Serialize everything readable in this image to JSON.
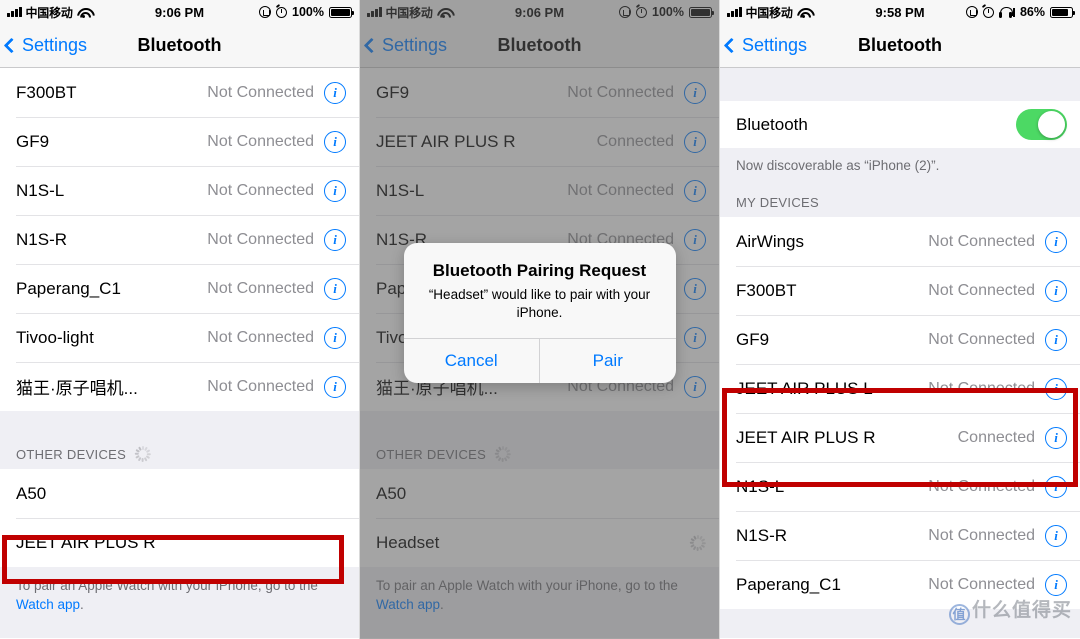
{
  "panels": [
    {
      "id": "panel-left",
      "statusbar": {
        "carrier": "中国移动",
        "time": "9:06 PM",
        "battery_percent": "100%",
        "icons": [
          "signal-bars-icon",
          "wifi-icon",
          "rotation-lock-icon",
          "alarm-clock-icon",
          "battery-icon"
        ]
      },
      "nav": {
        "back_label": "Settings",
        "title": "Bluetooth"
      },
      "devices": [
        {
          "name": "F300BT",
          "status": "Not Connected"
        },
        {
          "name": "GF9",
          "status": "Not Connected"
        },
        {
          "name": "N1S-L",
          "status": "Not Connected"
        },
        {
          "name": "N1S-R",
          "status": "Not Connected"
        },
        {
          "name": "Paperang_C1",
          "status": "Not Connected"
        },
        {
          "name": "Tivoo-light",
          "status": "Not Connected"
        },
        {
          "name": "猫王·原子唱机...",
          "status": "Not Connected"
        }
      ],
      "other_header": "OTHER DEVICES",
      "other_devices": [
        {
          "name": "A50",
          "status": ""
        },
        {
          "name": "JEET AIR PLUS R",
          "status": ""
        }
      ],
      "footer": {
        "text_before": "To pair an Apple Watch with your iPhone, go to the ",
        "link": "Watch app",
        "text_after": "."
      }
    },
    {
      "id": "panel-middle",
      "statusbar": {
        "carrier": "中国移动",
        "time": "9:06 PM",
        "battery_percent": "100%",
        "icons": [
          "signal-bars-icon",
          "wifi-icon",
          "rotation-lock-icon",
          "alarm-clock-icon",
          "battery-icon"
        ]
      },
      "nav": {
        "back_label": "Settings",
        "title": "Bluetooth"
      },
      "devices": [
        {
          "name": "GF9",
          "status": "Not Connected"
        },
        {
          "name": "JEET AIR PLUS R",
          "status": "Connected"
        },
        {
          "name": "N1S-L",
          "status": "Not Connected"
        },
        {
          "name": "N1S-R",
          "status": "Not Connected"
        },
        {
          "name": "Paperang_C1",
          "status": "Not Connected"
        },
        {
          "name": "Tivoo-light",
          "status": "Not Connected"
        },
        {
          "name": "猫王·原子唱机...",
          "status": "Not Connected"
        }
      ],
      "other_header": "OTHER DEVICES",
      "other_devices": [
        {
          "name": "A50",
          "status": ""
        },
        {
          "name": "Headset",
          "status": ""
        }
      ],
      "footer": {
        "text_before": "To pair an Apple Watch with your iPhone, go to the ",
        "link": "Watch app",
        "text_after": "."
      },
      "alert": {
        "title": "Bluetooth Pairing Request",
        "message": "“Headset” would like to pair with your iPhone.",
        "cancel_label": "Cancel",
        "confirm_label": "Pair"
      }
    },
    {
      "id": "panel-right",
      "statusbar": {
        "carrier": "中国移动",
        "time": "9:58 PM",
        "battery_percent": "86%",
        "icons": [
          "signal-bars-icon",
          "wifi-icon",
          "rotation-lock-icon",
          "alarm-clock-icon",
          "headphones-icon",
          "battery-icon"
        ]
      },
      "nav": {
        "back_label": "Settings",
        "title": "Bluetooth"
      },
      "bluetooth_row": {
        "label": "Bluetooth",
        "toggle_on": true
      },
      "discoverable_note": "Now discoverable as “iPhone (2)”.",
      "my_devices_header": "MY DEVICES",
      "devices": [
        {
          "name": "AirWings",
          "status": "Not Connected"
        },
        {
          "name": "F300BT",
          "status": "Not Connected"
        },
        {
          "name": "GF9",
          "status": "Not Connected"
        },
        {
          "name": "JEET AIR PLUS L",
          "status": "Not Connected"
        },
        {
          "name": "JEET AIR PLUS R",
          "status": "Connected"
        },
        {
          "name": "N1S-L",
          "status": "Not Connected"
        },
        {
          "name": "N1S-R",
          "status": "Not Connected"
        },
        {
          "name": "Paperang_C1",
          "status": "Not Connected"
        }
      ]
    }
  ],
  "watermark": {
    "mark": "值",
    "text": "什么值得买"
  },
  "colors": {
    "accent_blue": "#007aff",
    "toggle_green": "#4cd964",
    "highlight_red": "#c00000",
    "status_gray": "#8e8e93",
    "group_bg": "#efeff4"
  }
}
